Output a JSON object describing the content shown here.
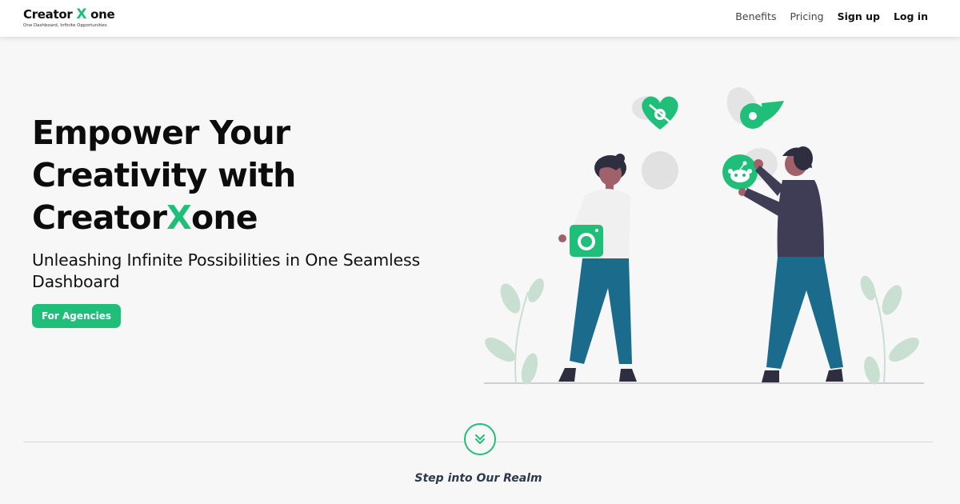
{
  "brand": {
    "name_part1": "Creator ",
    "name_x": "X",
    "name_part2": " one",
    "tagline": "One Dashboard, Infinite Opportunities"
  },
  "nav": {
    "items": [
      {
        "label": "Benefits"
      },
      {
        "label": "Pricing"
      },
      {
        "label": "Sign up"
      },
      {
        "label": "Log in"
      }
    ]
  },
  "hero": {
    "title_line1": "Empower Your",
    "title_line2": "Creativity with",
    "title_line3_part1": "Creator",
    "title_line3_x": "X",
    "title_line3_part2": "one",
    "subtitle": "Unleashing Infinite Possibilities in One Seamless Dashboard",
    "cta_label": "For Agencies"
  },
  "section": {
    "step_label": "Step into Our Realm"
  },
  "colors": {
    "accent": "#1fbf7a",
    "navy": "#3f3d56",
    "teal_pants": "#1a6b8c",
    "leaf": "#c9dfd2"
  },
  "icons": [
    "heart-logo-icon",
    "onlyfans-icon",
    "reddit-icon",
    "instagram-icon",
    "double-chevron-down-icon"
  ]
}
